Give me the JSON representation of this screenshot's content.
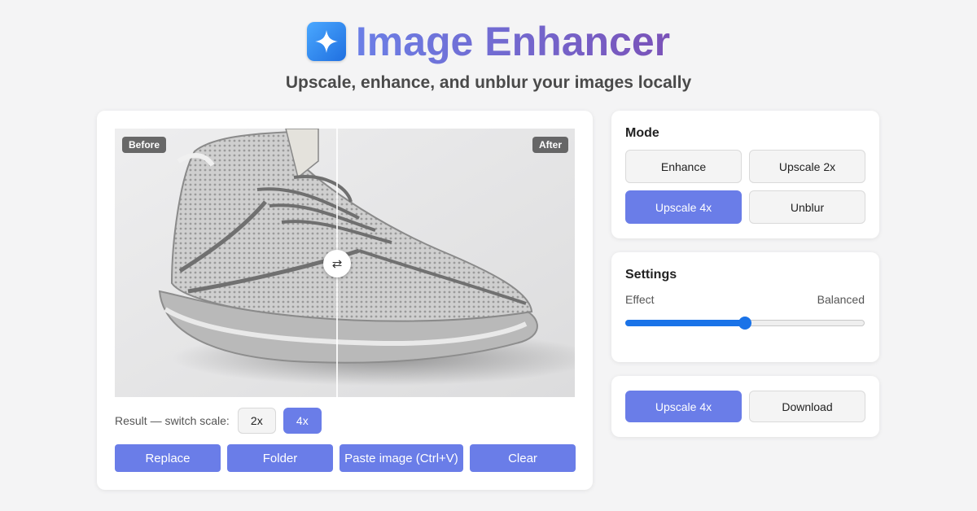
{
  "header": {
    "title": "Image Enhancer",
    "subtitle": "Upscale, enhance, and unblur your images locally",
    "logo_icon": "sparkle-icon"
  },
  "viewer": {
    "before_label": "Before",
    "after_label": "After",
    "handle_glyph": "⇄",
    "split_fraction": 0.48
  },
  "result": {
    "label": "Result — switch scale:",
    "options": [
      {
        "label": "2x",
        "selected": false
      },
      {
        "label": "4x",
        "selected": true
      }
    ]
  },
  "actions": {
    "replace": "Replace",
    "folder": "Folder",
    "paste": "Paste image (Ctrl+V)",
    "clear": "Clear"
  },
  "mode": {
    "title": "Mode",
    "options": [
      {
        "label": "Enhance",
        "selected": false
      },
      {
        "label": "Upscale 2x",
        "selected": false
      },
      {
        "label": "Upscale 4x",
        "selected": true
      },
      {
        "label": "Unblur",
        "selected": false
      }
    ]
  },
  "settings": {
    "title": "Settings",
    "effect_label": "Effect",
    "effect_value": "Balanced",
    "effect_level": 0.5
  },
  "download": {
    "run_label": "Upscale 4x",
    "download_label": "Download"
  },
  "colors": {
    "accent": "#6a7de8",
    "slider": "#1a73e8",
    "title_gradient_start": "#6b7fe6",
    "title_gradient_end": "#7a52b8"
  }
}
